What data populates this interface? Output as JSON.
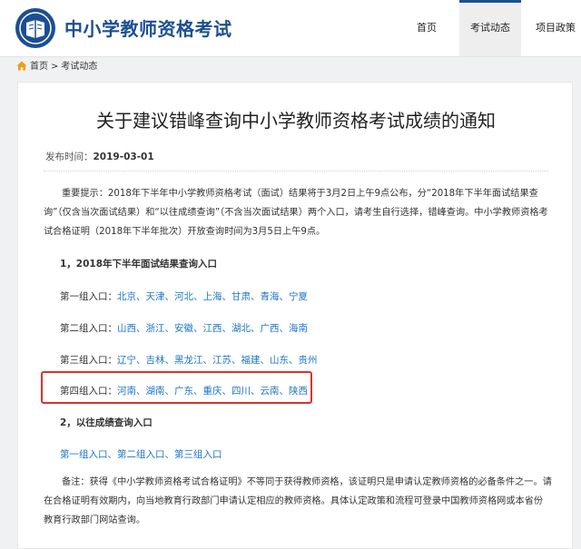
{
  "site": {
    "title": "中小学教师资格考试"
  },
  "nav": {
    "items": [
      "首页",
      "考试动态",
      "项目政策"
    ],
    "active": "考试动态"
  },
  "breadcrumb": {
    "home": "首页",
    "separator": ">",
    "current": "考试动态"
  },
  "article": {
    "title": "关于建议错峰查询中小学教师资格考试成绩的通知",
    "date_label": "发布时间：",
    "date": "2019-03-01",
    "intro": "重要提示：2018年下半年中小学教师资格考试（面试）结果将于3月2日上午9点公布，分“2018年下半年面试结果查询”（仅含当次面试结果）和“以往成绩查询”（不含当次面试结果）两个入口，请考生自行选择，错峰查询。中小学教师资格考试合格证明（2018年下半年批次）开放查询时间为3月5日上午9点。",
    "section1": "1，2018年下半年面试结果查询入口",
    "groups": [
      {
        "label": "第一组入口：",
        "regions": "北京、天津、河北、上海、甘肃、青海、宁夏"
      },
      {
        "label": "第二组入口：",
        "regions": "山西、浙江、安徽、江西、湖北、广西、海南"
      },
      {
        "label": "第三组入口：",
        "regions": "辽宁、吉林、黑龙江、江苏、福建、山东、贵州"
      },
      {
        "label": "第四组入口：",
        "regions": "河南、湖南、广东、重庆、四川、云南、陕西"
      }
    ],
    "section2": "2，以往成绩查询入口",
    "past_links": "第一组入口、第二组入口、第三组入口",
    "note": "备注：获得《中小学教师资格考试合格证明》不等同于获得教师资格，该证明只是申请认定教师资格的必备条件之一。请在合格证明有效期内，向当地教育行政部门申请认定相应的教师资格。具体认定政策和流程可登录中国教师资格网或本省份教育行政部门网站查询。"
  },
  "colors": {
    "brand": "#1b4f93",
    "link": "#1e74c8",
    "highlight": "#e0302a",
    "home_icon": "#f39c12"
  }
}
